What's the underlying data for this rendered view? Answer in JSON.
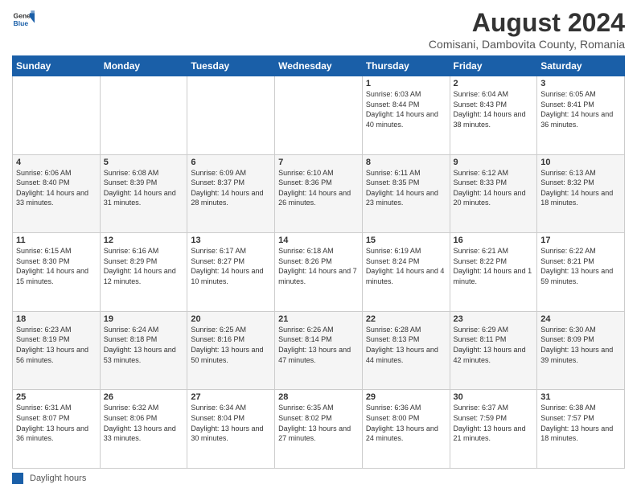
{
  "header": {
    "logo": {
      "line1": "General",
      "line2": "Blue"
    },
    "title": "August 2024",
    "location": "Comisani, Dambovita County, Romania"
  },
  "calendar": {
    "weekdays": [
      "Sunday",
      "Monday",
      "Tuesday",
      "Wednesday",
      "Thursday",
      "Friday",
      "Saturday"
    ],
    "weeks": [
      [
        {
          "day": "",
          "info": ""
        },
        {
          "day": "",
          "info": ""
        },
        {
          "day": "",
          "info": ""
        },
        {
          "day": "",
          "info": ""
        },
        {
          "day": "1",
          "info": "Sunrise: 6:03 AM\nSunset: 8:44 PM\nDaylight: 14 hours and 40 minutes."
        },
        {
          "day": "2",
          "info": "Sunrise: 6:04 AM\nSunset: 8:43 PM\nDaylight: 14 hours and 38 minutes."
        },
        {
          "day": "3",
          "info": "Sunrise: 6:05 AM\nSunset: 8:41 PM\nDaylight: 14 hours and 36 minutes."
        }
      ],
      [
        {
          "day": "4",
          "info": "Sunrise: 6:06 AM\nSunset: 8:40 PM\nDaylight: 14 hours and 33 minutes."
        },
        {
          "day": "5",
          "info": "Sunrise: 6:08 AM\nSunset: 8:39 PM\nDaylight: 14 hours and 31 minutes."
        },
        {
          "day": "6",
          "info": "Sunrise: 6:09 AM\nSunset: 8:37 PM\nDaylight: 14 hours and 28 minutes."
        },
        {
          "day": "7",
          "info": "Sunrise: 6:10 AM\nSunset: 8:36 PM\nDaylight: 14 hours and 26 minutes."
        },
        {
          "day": "8",
          "info": "Sunrise: 6:11 AM\nSunset: 8:35 PM\nDaylight: 14 hours and 23 minutes."
        },
        {
          "day": "9",
          "info": "Sunrise: 6:12 AM\nSunset: 8:33 PM\nDaylight: 14 hours and 20 minutes."
        },
        {
          "day": "10",
          "info": "Sunrise: 6:13 AM\nSunset: 8:32 PM\nDaylight: 14 hours and 18 minutes."
        }
      ],
      [
        {
          "day": "11",
          "info": "Sunrise: 6:15 AM\nSunset: 8:30 PM\nDaylight: 14 hours and 15 minutes."
        },
        {
          "day": "12",
          "info": "Sunrise: 6:16 AM\nSunset: 8:29 PM\nDaylight: 14 hours and 12 minutes."
        },
        {
          "day": "13",
          "info": "Sunrise: 6:17 AM\nSunset: 8:27 PM\nDaylight: 14 hours and 10 minutes."
        },
        {
          "day": "14",
          "info": "Sunrise: 6:18 AM\nSunset: 8:26 PM\nDaylight: 14 hours and 7 minutes."
        },
        {
          "day": "15",
          "info": "Sunrise: 6:19 AM\nSunset: 8:24 PM\nDaylight: 14 hours and 4 minutes."
        },
        {
          "day": "16",
          "info": "Sunrise: 6:21 AM\nSunset: 8:22 PM\nDaylight: 14 hours and 1 minute."
        },
        {
          "day": "17",
          "info": "Sunrise: 6:22 AM\nSunset: 8:21 PM\nDaylight: 13 hours and 59 minutes."
        }
      ],
      [
        {
          "day": "18",
          "info": "Sunrise: 6:23 AM\nSunset: 8:19 PM\nDaylight: 13 hours and 56 minutes."
        },
        {
          "day": "19",
          "info": "Sunrise: 6:24 AM\nSunset: 8:18 PM\nDaylight: 13 hours and 53 minutes."
        },
        {
          "day": "20",
          "info": "Sunrise: 6:25 AM\nSunset: 8:16 PM\nDaylight: 13 hours and 50 minutes."
        },
        {
          "day": "21",
          "info": "Sunrise: 6:26 AM\nSunset: 8:14 PM\nDaylight: 13 hours and 47 minutes."
        },
        {
          "day": "22",
          "info": "Sunrise: 6:28 AM\nSunset: 8:13 PM\nDaylight: 13 hours and 44 minutes."
        },
        {
          "day": "23",
          "info": "Sunrise: 6:29 AM\nSunset: 8:11 PM\nDaylight: 13 hours and 42 minutes."
        },
        {
          "day": "24",
          "info": "Sunrise: 6:30 AM\nSunset: 8:09 PM\nDaylight: 13 hours and 39 minutes."
        }
      ],
      [
        {
          "day": "25",
          "info": "Sunrise: 6:31 AM\nSunset: 8:07 PM\nDaylight: 13 hours and 36 minutes."
        },
        {
          "day": "26",
          "info": "Sunrise: 6:32 AM\nSunset: 8:06 PM\nDaylight: 13 hours and 33 minutes."
        },
        {
          "day": "27",
          "info": "Sunrise: 6:34 AM\nSunset: 8:04 PM\nDaylight: 13 hours and 30 minutes."
        },
        {
          "day": "28",
          "info": "Sunrise: 6:35 AM\nSunset: 8:02 PM\nDaylight: 13 hours and 27 minutes."
        },
        {
          "day": "29",
          "info": "Sunrise: 6:36 AM\nSunset: 8:00 PM\nDaylight: 13 hours and 24 minutes."
        },
        {
          "day": "30",
          "info": "Sunrise: 6:37 AM\nSunset: 7:59 PM\nDaylight: 13 hours and 21 minutes."
        },
        {
          "day": "31",
          "info": "Sunrise: 6:38 AM\nSunset: 7:57 PM\nDaylight: 13 hours and 18 minutes."
        }
      ]
    ]
  },
  "footer": {
    "legend_label": "Daylight hours"
  }
}
